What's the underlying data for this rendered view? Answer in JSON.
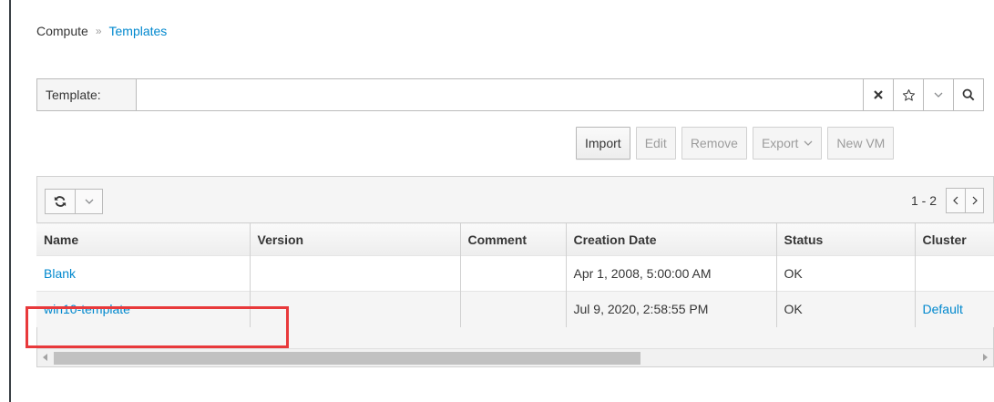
{
  "breadcrumb": {
    "section": "Compute",
    "separator": "»",
    "current": "Templates"
  },
  "search": {
    "label": "Template:",
    "value": "",
    "placeholder": ""
  },
  "toolbar": {
    "import": "Import",
    "edit": "Edit",
    "remove": "Remove",
    "export": "Export",
    "new_vm": "New VM"
  },
  "pager": {
    "count": "1 - 2",
    "prev": "‹",
    "next": "›"
  },
  "table": {
    "columns": [
      "Name",
      "Version",
      "Comment",
      "Creation Date",
      "Status",
      "Cluster"
    ],
    "rows": [
      {
        "name": "Blank",
        "version": "",
        "comment": "",
        "creation_date": "Apr 1, 2008, 5:00:00 AM",
        "status": "OK",
        "cluster": ""
      },
      {
        "name": "win10-template",
        "version": "",
        "comment": "",
        "creation_date": "Jul 9, 2020, 2:58:55 PM",
        "status": "OK",
        "cluster": "Default"
      }
    ]
  },
  "colors": {
    "link": "#0088ce",
    "highlight": "#e8393b"
  },
  "icons": [
    "clear-icon",
    "star-icon",
    "chevron-down-icon",
    "search-icon",
    "refresh-icon"
  ]
}
